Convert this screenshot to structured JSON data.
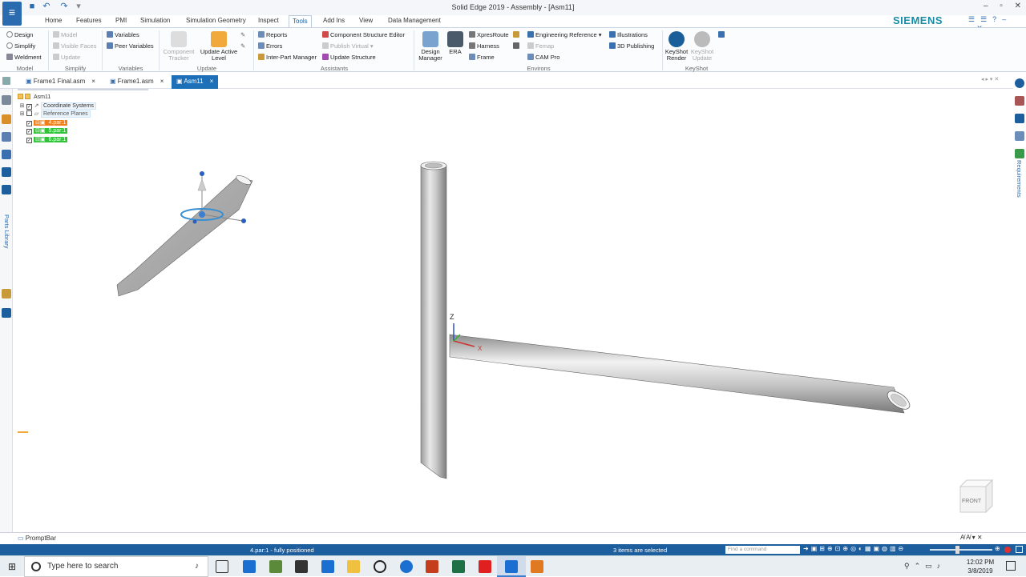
{
  "window": {
    "title": "Solid Edge 2019 - Assembly - [Asm11]",
    "brand": "SIEMENS",
    "controls": [
      "–",
      "▫",
      "✕"
    ],
    "mdi_controls": [
      "–",
      "▫",
      "✕"
    ]
  },
  "ribbon_tabs": [
    "Home",
    "Features",
    "PMI",
    "Simulation",
    "Simulation Geometry",
    "Inspect",
    "Tools",
    "Add Ins",
    "View",
    "Data Management"
  ],
  "active_tab": "Tools",
  "ribbon": {
    "model": {
      "group": "Model",
      "items": [
        "Design",
        "Simplify",
        "Weldment"
      ]
    },
    "simplify": {
      "group": "Simplify",
      "items": [
        "Model",
        "Visible Faces",
        "Update"
      ]
    },
    "variables": {
      "group": "Variables",
      "items": [
        "Variables",
        "Peer Variables"
      ]
    },
    "update": {
      "group": "Update",
      "component_tracker": "Component Tracker",
      "update_active_level": "Update Active Level"
    },
    "assistants": {
      "group": "Assistants",
      "items": [
        "Reports",
        "Errors",
        "Inter-Part Manager",
        "Component Structure Editor",
        "Publish Virtual",
        "Update Structure"
      ]
    },
    "environs": {
      "group": "Environs",
      "design_manager": "Design Manager",
      "era": "ERA",
      "items": [
        "XpresRoute",
        "Harness",
        "Frame",
        "Engineering Reference",
        "Femap",
        "CAM Pro"
      ]
    },
    "publishing": {
      "items": [
        "Illustrations",
        "3D Publishing"
      ]
    },
    "keyshot": {
      "group": "KeyShot",
      "render": "KeyShot Render",
      "update": "KeyShot Update"
    }
  },
  "document_tabs": [
    {
      "label": "Frame1 Final.asm",
      "close": "×"
    },
    {
      "label": "Frame1.asm",
      "close": "×"
    },
    {
      "label": "Asm11",
      "close": "×"
    }
  ],
  "active_document": "Asm11",
  "pathfinder": {
    "root": "Asm11",
    "items": [
      {
        "label": "Coordinate Systems",
        "checked": true
      },
      {
        "label": "Reference Planes",
        "checked": false
      },
      {
        "label": "4.par:1",
        "checked": true,
        "color": "#f07f1a"
      },
      {
        "label": "5.par:1",
        "checked": true,
        "color": "#32c23a"
      },
      {
        "label": "6.par:1",
        "checked": true,
        "color": "#32c23a"
      }
    ]
  },
  "side_panels": {
    "left": "Parts Library",
    "right": "Requirements"
  },
  "viewport": {
    "axis_z": "Z",
    "axis_x": "X",
    "view_cube_label": "FRONT"
  },
  "prompt_bar": {
    "label": "PromptBar"
  },
  "status_bar": {
    "message": "4.par:1 - fully positioned",
    "selection": "3 items are selected",
    "find_placeholder": "Find a command"
  },
  "taskbar": {
    "search_placeholder": "Type here to search",
    "time": "12:02 PM",
    "date": "3/8/2019"
  },
  "colors": {
    "accent": "#1d5e9e",
    "tab_active": "#1d6fb8",
    "orange": "#f07f1a",
    "green": "#32c23a"
  }
}
